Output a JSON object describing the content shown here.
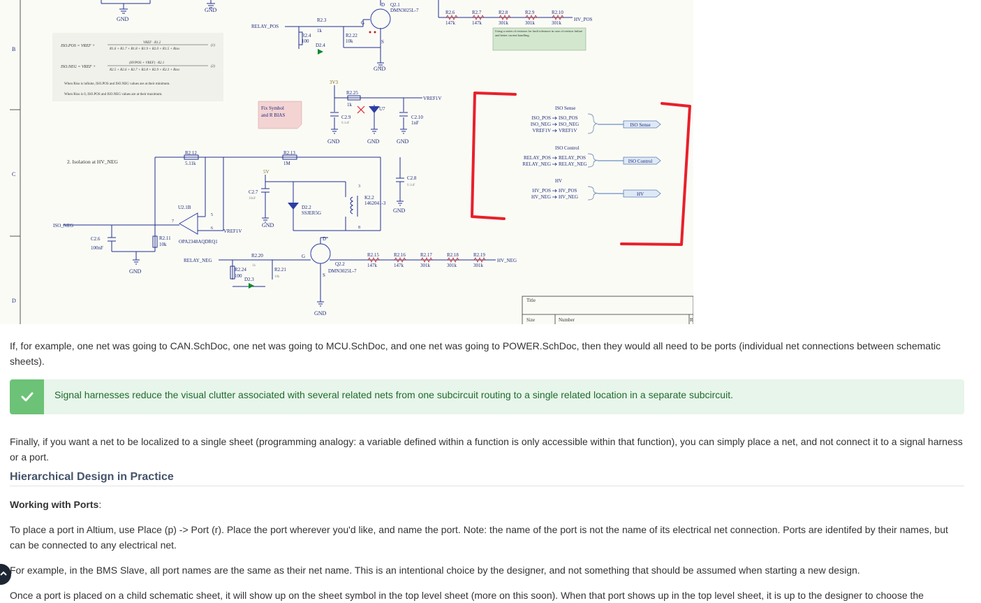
{
  "schematic": {
    "row_labels": [
      "B",
      "C",
      "D"
    ],
    "equations": {
      "iso_pos": "ISO.POS = VREF + ",
      "iso_pos_num": "VREF · R1.2",
      "iso_pos_den": "R1.6 + R1.7 + R1.8 + R1.9 + R2.0 + R1.5 + Riso",
      "iso_pos_tag": "(1)",
      "iso_neg": "ISO.NEG = VREF + ",
      "iso_neg_num": "(HVPOS + VREF) · R2.1",
      "iso_neg_den": "R2.5 + R2.6 + R2.7 + R2.8 + R2.9 + R2.3 + Riso",
      "iso_neg_tag": "(2)",
      "note1": "When Riso is infinite, ISO.POS and ISO.NEG values are at their minimum.",
      "note2": "When Riso is 0, ISO.POS and ISO.NEG values are at their maximum."
    },
    "gnd_label": "GND",
    "relay_pos": "RELAY_POS",
    "relay_neg": "RELAY_NEG",
    "r23": "R2.3",
    "r23v": "1k",
    "r24": "R2.4",
    "r24v": "100",
    "d24": "D2.4",
    "r222": "R2.22",
    "r222v": "10k",
    "q21": "Q2.1",
    "q21p": "DMN3025L-7",
    "g_pin": "G",
    "d_pin": "D",
    "s_pin": "S",
    "res_top": [
      {
        "ref": "R2.6",
        "val": "147k"
      },
      {
        "ref": "R2.7",
        "val": "147k"
      },
      {
        "ref": "R2.8",
        "val": "301k"
      },
      {
        "ref": "R2.9",
        "val": "301k"
      },
      {
        "ref": "R2.10",
        "val": "301k"
      }
    ],
    "hv_pos": "HV_POS",
    "note_tolerance": "Using a series of resistors for fault tolerance in case of resistor failure and better current handling.",
    "v3v3": "3V3",
    "r225": "R2.25",
    "r225v": "1k",
    "vref1v": "VREF1V",
    "c29": "C2.9",
    "c29v": "0.1uF",
    "u7": "U7",
    "c210": "C2.10",
    "c210v": "1nF",
    "fix_note_1": "Fix Symbol",
    "fix_note_2": "and R BIAS",
    "iso_label": "2. Isolation at HV_NEG",
    "r212": "R2.12",
    "r212v": "5.11k",
    "r213": "R2.13",
    "r213v": "1M",
    "v5v": "5V",
    "c27": "C2.7",
    "c27v": "10uF",
    "d22": "D2.2",
    "d22p": "SSJER5G",
    "k22": "K2.2",
    "k22p": "1462041-3",
    "c28": "C2.8",
    "c28v": "0.1uF",
    "u21b": "U2.1B",
    "opa": "OPA2348AQDRQ1",
    "pin5": "5",
    "pin6": "6",
    "pin7": "7",
    "pin3": "3",
    "pin8": "8",
    "iso_neg_net": "ISO_NEG",
    "c26": "C2.6",
    "c26v": "100nF",
    "r211": "R2.11",
    "r211v": "10k",
    "r220": "R2.20",
    "r220v": "1k",
    "r224": "R2.24",
    "r224v": "100",
    "r221": "R2.21",
    "r221v": "10k",
    "d23": "D2.3",
    "q22": "Q2.2",
    "q22p": "DMN3025L-7",
    "res_bot": [
      {
        "ref": "R2.15",
        "val": "147k"
      },
      {
        "ref": "R2.16",
        "val": "147k"
      },
      {
        "ref": "R2.17",
        "val": "301k"
      },
      {
        "ref": "R2.18",
        "val": "301k"
      },
      {
        "ref": "R2.19",
        "val": "301k"
      }
    ],
    "hv_neg": "HV_NEG",
    "harness": {
      "iso_sense_title": "ISO Sense",
      "iso_sense_left": [
        "ISO_POS",
        "ISO_NEG",
        "VREF1V"
      ],
      "iso_sense_right": [
        "ISO_POS",
        "ISO_NEG",
        "VREF1V"
      ],
      "iso_sense_port": "ISO Sense",
      "iso_ctrl_title": "ISO Control",
      "iso_ctrl_left": [
        "RELAY_POS",
        "RELAY_NEG"
      ],
      "iso_ctrl_right": [
        "RELAY_POS",
        "RELAY_NEG"
      ],
      "iso_ctrl_port": "ISO Control",
      "hv_title": "HV",
      "hv_left": [
        "HV_POS",
        "HV_NEG"
      ],
      "hv_right": [
        "HV_POS",
        "HV_NEG"
      ],
      "hv_port": "HV"
    },
    "titleblock": {
      "title": "Title",
      "size": "Size",
      "number": "Number",
      "rev": "R"
    },
    "annotation_color": "#e8202a",
    "wire_color": "#1f2f8f",
    "component_color": "#2b3ea3",
    "power_color": "#7a6a10"
  },
  "content": {
    "p1": "If, for example, one net was going to CAN.SchDoc, one net was going to MCU.SchDoc, and one net was going to POWER.SchDoc, then they would all need to be ports (individual net connections between schematic sheets).",
    "tip": "Signal harnesses reduce the visual clutter associated with several related nets from one subcircuit routing to a single related location in a separate subcircuit.",
    "p2": "Finally, if you want a net to be localized to a single sheet (programming analogy: a variable defined within a function is only accessible within that function), you can simply place a net, and not connect it to a signal harness or a port.",
    "h3": "Hierarchical Design in Practice",
    "working_strong": "Working with Ports",
    "working_colon": ":",
    "p3": "To place a port in Altium, use Place (p) -> Port (r). Place the port wherever you'd like, and name the port. Note: the name of the port is not the name of its electrical net connection. Ports are identifed by their names, but can be connected to any electrical net.",
    "p4": "For example, in the BMS Slave, all port names are the same as their net name. This is an intentional choice by the designer, and not something that should be assumed when starting a new design.",
    "p5": "Once a port is placed on a child schematic sheet, it will show up on the sheet symbol in the top level sheet (more on this soon). When that port shows up in the top level sheet, it is up to the designer to choose the"
  }
}
